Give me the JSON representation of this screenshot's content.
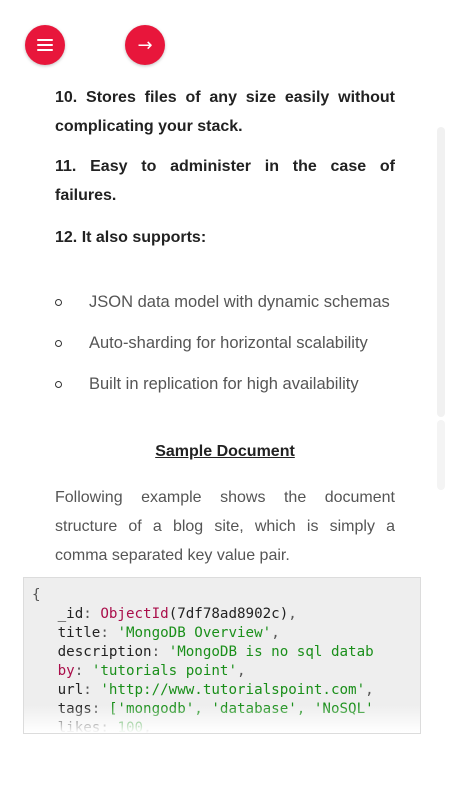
{
  "nav": {
    "menu_icon": "hamburger-menu-icon",
    "next_icon": "arrow-right-icon",
    "next_glyph": "→",
    "accent": "#e8163b"
  },
  "features": [
    {
      "text": "10. Stores files of any size easily without complicating your stack."
    },
    {
      "text": "11. Easy to administer in the case of failures."
    },
    {
      "text": "12. It also supports:"
    }
  ],
  "supports": [
    "JSON data model with dynamic schemas",
    "Auto-sharding for horizontal scalability",
    "Built in replication for high availability"
  ],
  "sample": {
    "title": "Sample Document",
    "intro": "Following example shows the document structure of a blog site, which is simply a comma separated key value pair.",
    "code": {
      "open_brace": "{",
      "id_key": "_id",
      "id_func": "ObjectId",
      "id_value": "(7df78ad8902c)",
      "title_key": "title",
      "title_value": "'MongoDB Overview'",
      "description_key": "description",
      "description_value": "'MongoDB is no sql datab",
      "by_key": "by",
      "by_value": "'tutorials point'",
      "url_key": "url",
      "url_value": "'http://www.tutorialspoint.com'",
      "tags_key": "tags",
      "tags_value": "['mongodb', 'database', 'NoSQL'",
      "likes_key": "likes",
      "likes_value": "100"
    }
  }
}
